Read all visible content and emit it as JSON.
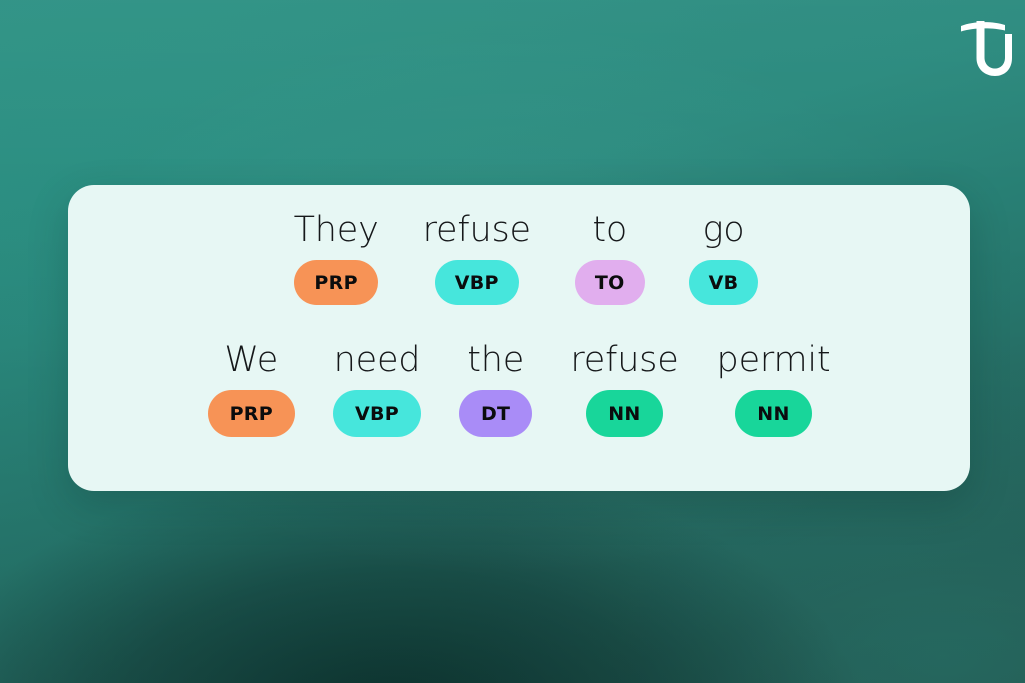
{
  "brand": {
    "logo_icon": "tu-monogram-logo",
    "logo_color": "#ffffff"
  },
  "theme": {
    "background_top": "#2e9083",
    "background_bottom": "#265b54",
    "card_background": "#e7f7f4"
  },
  "card": {
    "rows": [
      {
        "row_label": "sentence-1",
        "tokens": [
          {
            "word": "They",
            "tag": "PRP",
            "tag_color": "#f79356"
          },
          {
            "word": "refuse",
            "tag": "VBP",
            "tag_color": "#46e6dc"
          },
          {
            "word": "to",
            "tag": "TO",
            "tag_color": "#e1aeee"
          },
          {
            "word": "go",
            "tag": "VB",
            "tag_color": "#46e6dc"
          }
        ]
      },
      {
        "row_label": "sentence-2",
        "tokens": [
          {
            "word": "We",
            "tag": "PRP",
            "tag_color": "#f79356"
          },
          {
            "word": "need",
            "tag": "VBP",
            "tag_color": "#46e6dc"
          },
          {
            "word": "the",
            "tag": "DT",
            "tag_color": "#a98cf7"
          },
          {
            "word": "refuse",
            "tag": "NN",
            "tag_color": "#18d69a"
          },
          {
            "word": "permit",
            "tag": "NN",
            "tag_color": "#18d69a"
          }
        ]
      }
    ]
  }
}
